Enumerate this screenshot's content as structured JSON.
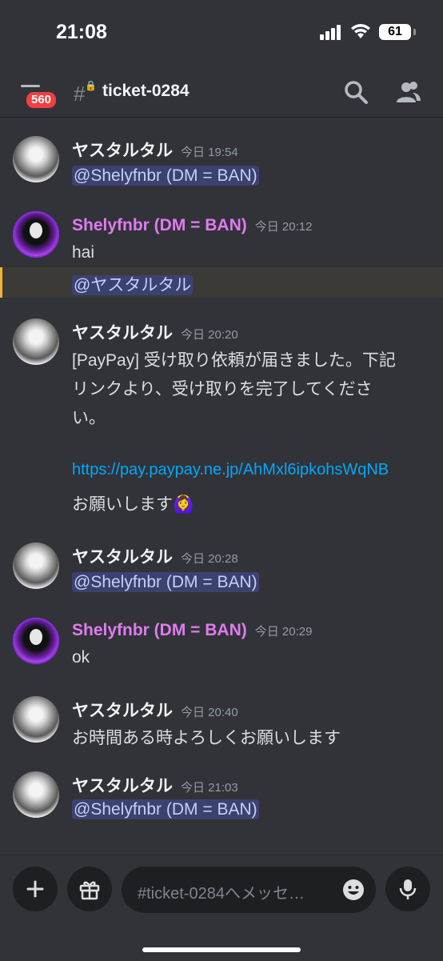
{
  "status": {
    "time": "21:08",
    "battery": "61"
  },
  "header": {
    "unread_badge": "560",
    "channel_name": "ticket-0284"
  },
  "messages": [
    {
      "author": "ヤスタルタル",
      "timestamp": "今日 19:54",
      "mention": "@Shelyfnbr (DM = BAN)"
    },
    {
      "author": "Shelyfnbr (DM = BAN)",
      "timestamp": "今日 20:12",
      "text": "hai",
      "mention": "@ヤスタルタル"
    },
    {
      "author": "ヤスタルタル",
      "timestamp": "今日 20:20",
      "lines": [
        "[PayPay] 受け取り依頼が届きました。下記",
        "リンクより、受け取りを完了してくださ",
        "い。"
      ],
      "link": "https://pay.paypay.ne.jp/AhMxl6ipkohsWqNB",
      "closing": "お願いします🙆‍♀️"
    },
    {
      "author": "ヤスタルタル",
      "timestamp": "今日 20:28",
      "mention": "@Shelyfnbr (DM = BAN)"
    },
    {
      "author": "Shelyfnbr (DM = BAN)",
      "timestamp": "今日 20:29",
      "text": "ok"
    },
    {
      "author": "ヤスタルタル",
      "timestamp": "今日 20:40",
      "text": "お時間ある時よろしくお願いします"
    },
    {
      "author": "ヤスタルタル",
      "timestamp": "今日 21:03",
      "mention": "@Shelyfnbr (DM = BAN)"
    }
  ],
  "composer": {
    "placeholder": "#ticket-0284へメッセ…"
  },
  "colors": {
    "background": "#313338",
    "mention": "#3c4270",
    "link": "#00a8fc",
    "author_b": "#e07bf0",
    "highlight": "#f0b232"
  },
  "icons": [
    "signal-icon",
    "wifi-icon",
    "battery-icon",
    "menu-icon",
    "channel-hash-lock-icon",
    "search-icon",
    "members-icon",
    "plus-icon",
    "gift-icon",
    "emoji-icon",
    "microphone-icon"
  ]
}
